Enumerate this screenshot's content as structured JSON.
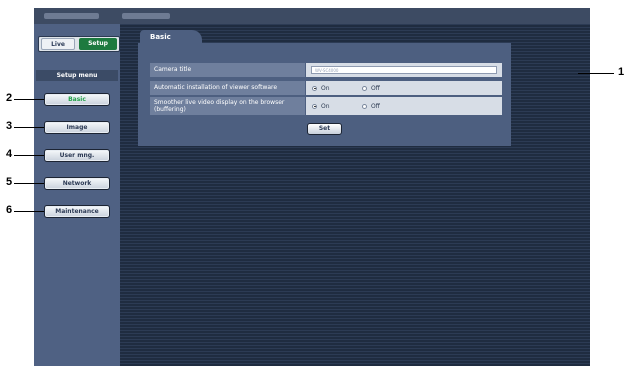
{
  "callouts": {
    "n1": "1",
    "n2": "2",
    "n3": "3",
    "n4": "4",
    "n5": "5",
    "n6": "6"
  },
  "mode": {
    "live": "Live",
    "setup": "Setup"
  },
  "sidebar": {
    "title": "Setup menu",
    "items": [
      "Basic",
      "Image",
      "User mng.",
      "Network",
      "Maintenance"
    ],
    "active": "Basic",
    "active_color": "#23a24a"
  },
  "tab": {
    "label": "Basic"
  },
  "form": {
    "camera_title_label": "Camera title",
    "camera_title_value": "WV-SC4000",
    "viewer_label": "Automatic installation of viewer software",
    "viewer_on": "On",
    "viewer_off": "Off",
    "viewer_selected": "On",
    "smoother_label": "Smoother live video display on the browser (buffering)",
    "smoother_on": "On",
    "smoother_off": "Off",
    "smoother_selected": "On",
    "set_label": "Set"
  },
  "colors": {
    "setup_active": "#1d7a3f",
    "panel": "#4d5f80"
  }
}
